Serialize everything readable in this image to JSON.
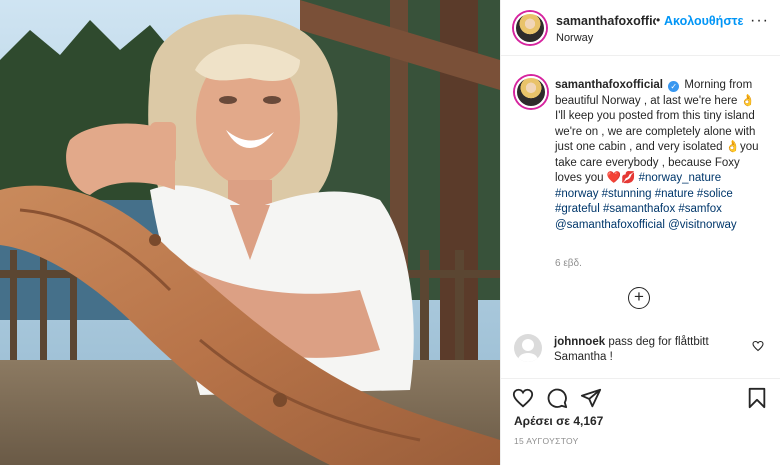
{
  "post": {
    "author": "samanthafoxofficial",
    "separator": "•",
    "follow_label": "Ακολουθήστε",
    "location": "Norway",
    "more_label": "···"
  },
  "caption": {
    "username": "samanthafoxofficial",
    "verified_mark": "✓",
    "text_1": "Morning from beautiful Norway , at last we're here ",
    "emoji_1": "👌",
    "text_2": "I'll keep you posted from this tiny island we're on , we are completely alone with just one cabin , and very isolated ",
    "emoji_2": "👌",
    "text_3": "you take care everybody , because Foxy loves you ",
    "emoji_3": "❤️💋",
    "hashtags": "#norway_nature #norway #stunning #nature #solice #grateful #samanthafox #samfox @samanthafoxofficial @visitnorway",
    "time_ago": "6 εβδ."
  },
  "load_more_symbol": "+",
  "comment": {
    "username": "johnnoek",
    "text": "pass deg for flåttbitt Samantha !"
  },
  "likes": "Αρέσει σε 4,167",
  "date": "15 ΑΥΓΟΥΣΤΟΥ",
  "icons": [
    "heart-icon",
    "comment-icon",
    "share-icon",
    "bookmark-icon",
    "heart-small-icon",
    "plus-circle-icon",
    "verified-icon"
  ]
}
